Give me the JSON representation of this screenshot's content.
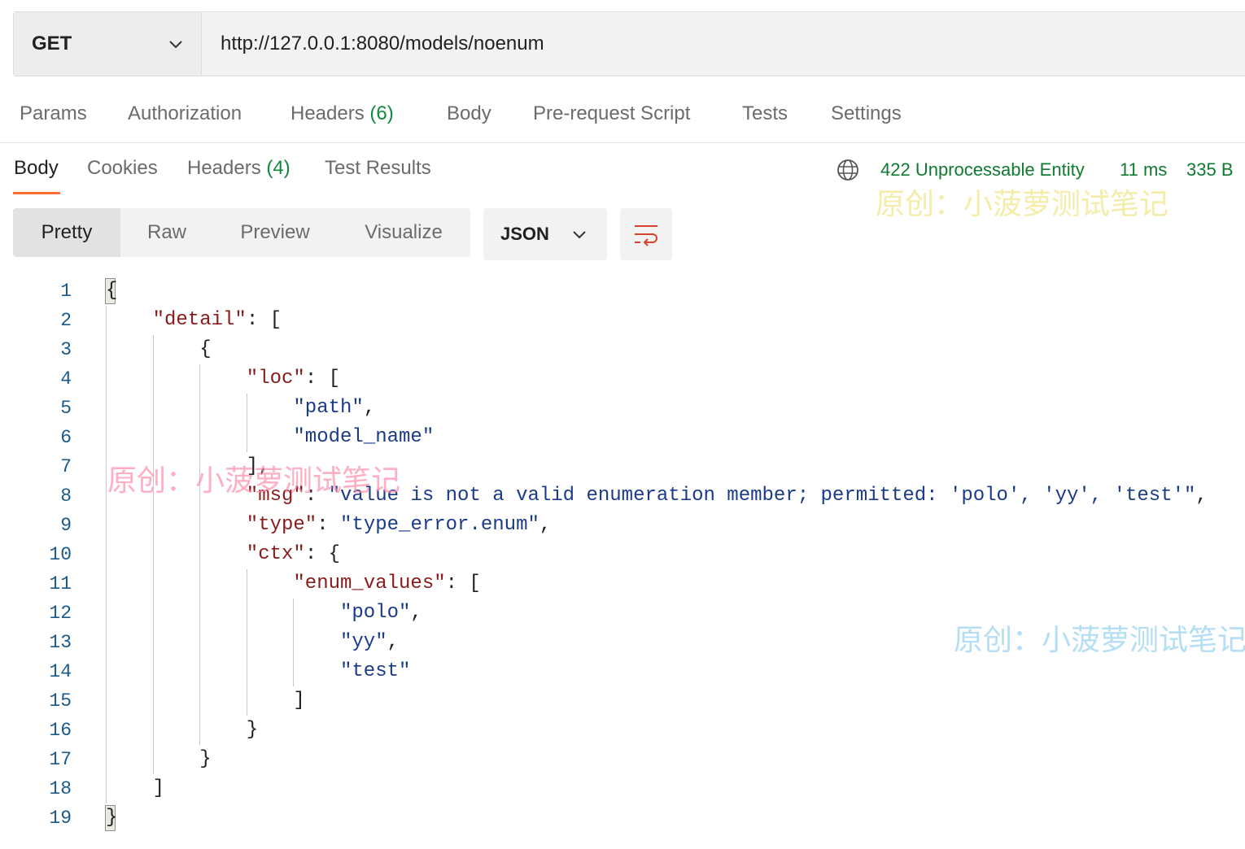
{
  "request": {
    "method": "GET",
    "url": "http://127.0.0.1:8080/models/noenum"
  },
  "request_tabs": {
    "params": "Params",
    "authorization": "Authorization",
    "headers": "Headers",
    "headers_count": "(6)",
    "body": "Body",
    "pre_request_script": "Pre-request Script",
    "tests": "Tests",
    "settings": "Settings"
  },
  "response_tabs": {
    "body": "Body",
    "cookies": "Cookies",
    "headers": "Headers",
    "headers_count": "(4)",
    "test_results": "Test Results",
    "active": "Body"
  },
  "response_status": {
    "status": "422 Unprocessable Entity",
    "time": "11 ms",
    "size": "335 B",
    "status_color": "#0f7a30",
    "icon": "globe-icon"
  },
  "view_modes": {
    "pretty": "Pretty",
    "raw": "Raw",
    "preview": "Preview",
    "visualize": "Visualize",
    "active": "Pretty"
  },
  "format": {
    "selected": "JSON",
    "wrap_icon": "wrap-lines-icon"
  },
  "code": {
    "line_numbers": [
      "1",
      "2",
      "3",
      "4",
      "5",
      "6",
      "7",
      "8",
      "9",
      "10",
      "11",
      "12",
      "13",
      "14",
      "15",
      "16",
      "17",
      "18",
      "19"
    ],
    "lines": [
      "{",
      "\"detail\": [",
      "{",
      "\"loc\": [",
      "\"path\",",
      "\"model_name\"",
      "],",
      "\"msg\": \"value is not a valid enumeration member; permitted: 'polo', 'yy', 'test'\",",
      "\"type\": \"type_error.enum\",",
      "\"ctx\": {",
      "\"enum_values\": [",
      "\"polo\",",
      "\"yy\",",
      "\"test\"",
      "]",
      "}",
      "}",
      "]",
      "}"
    ]
  },
  "watermark": "原创：小菠萝测试笔记",
  "colors": {
    "accent": "#ff6c37",
    "count_green": "#0f8a3c",
    "json_key": "#8b1a1a",
    "json_string": "#1a3a8a",
    "line_number": "#1a5a8a"
  }
}
